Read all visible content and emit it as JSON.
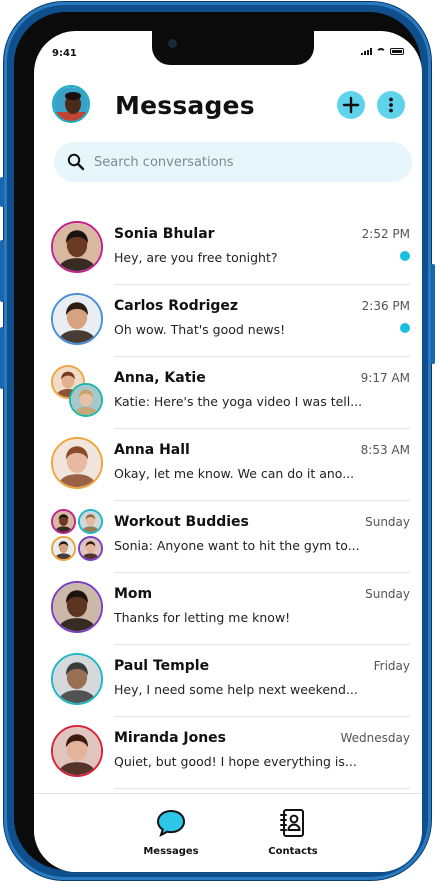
{
  "status_bar": {
    "time": "9:41"
  },
  "header": {
    "title": "Messages"
  },
  "search": {
    "placeholder": "Search conversations"
  },
  "conversations": [
    {
      "name": "Sonia Bhular",
      "time": "2:52 PM",
      "preview": "Hey, are you free tonight?",
      "unread": true,
      "ring": "#c0238f",
      "skin": "#6a3b22",
      "hair": "#1a120c",
      "bg": "#d9b8a2"
    },
    {
      "name": "Carlos Rodrigez",
      "time": "2:36 PM",
      "preview": "Oh wow. That's good news!",
      "unread": true,
      "ring": "#4a8fd6",
      "skin": "#d7a27f",
      "hair": "#2b1d15",
      "bg": "#e8eef2"
    },
    {
      "name": "Anna, Katie",
      "time": "9:17 AM",
      "preview": "Katie: Here's the yoga video I was tell...",
      "unread": false,
      "group": true,
      "ring": "#f0a43c",
      "ring2": "#18b8ae"
    },
    {
      "name": "Anna Hall",
      "time": "8:53 AM",
      "preview": "Okay, let me know. We can do it ano...",
      "unread": false,
      "ring": "#f0a43c",
      "skin": "#e6b9a0",
      "hair": "#8a4a2a",
      "bg": "#f1e4dc"
    },
    {
      "name": "Workout Buddies",
      "time": "Sunday",
      "preview": "Sonia: Anyone want to hit the gym to...",
      "unread": false,
      "group4": true
    },
    {
      "name": "Mom",
      "time": "Sunday",
      "preview": "Thanks for letting me know!",
      "unread": false,
      "ring": "#7a3fc0",
      "skin": "#5c3520",
      "hair": "#1b130d",
      "bg": "#cbb8a8"
    },
    {
      "name": "Paul Temple",
      "time": "Friday",
      "preview": "Hey, I need some help next weekend...",
      "unread": false,
      "ring": "#1fb7c8",
      "skin": "#9a7055",
      "hair": "#3a3a3a",
      "bg": "#d5d9dc"
    },
    {
      "name": "Miranda Jones",
      "time": "Wednesday",
      "preview": "Quiet, but good! I hope everything is...",
      "unread": false,
      "ring": "#d8233a",
      "skin": "#e3b49a",
      "hair": "#3b1b10",
      "bg": "#e0c4be"
    }
  ],
  "tabs": [
    {
      "label": "Messages",
      "icon": "chat-bubble-icon"
    },
    {
      "label": "Contacts",
      "icon": "contacts-book-icon"
    }
  ],
  "colors": {
    "accent": "#5fd3ec",
    "unread_dot": "#19bfe0",
    "frame": "#0f4f8c"
  }
}
